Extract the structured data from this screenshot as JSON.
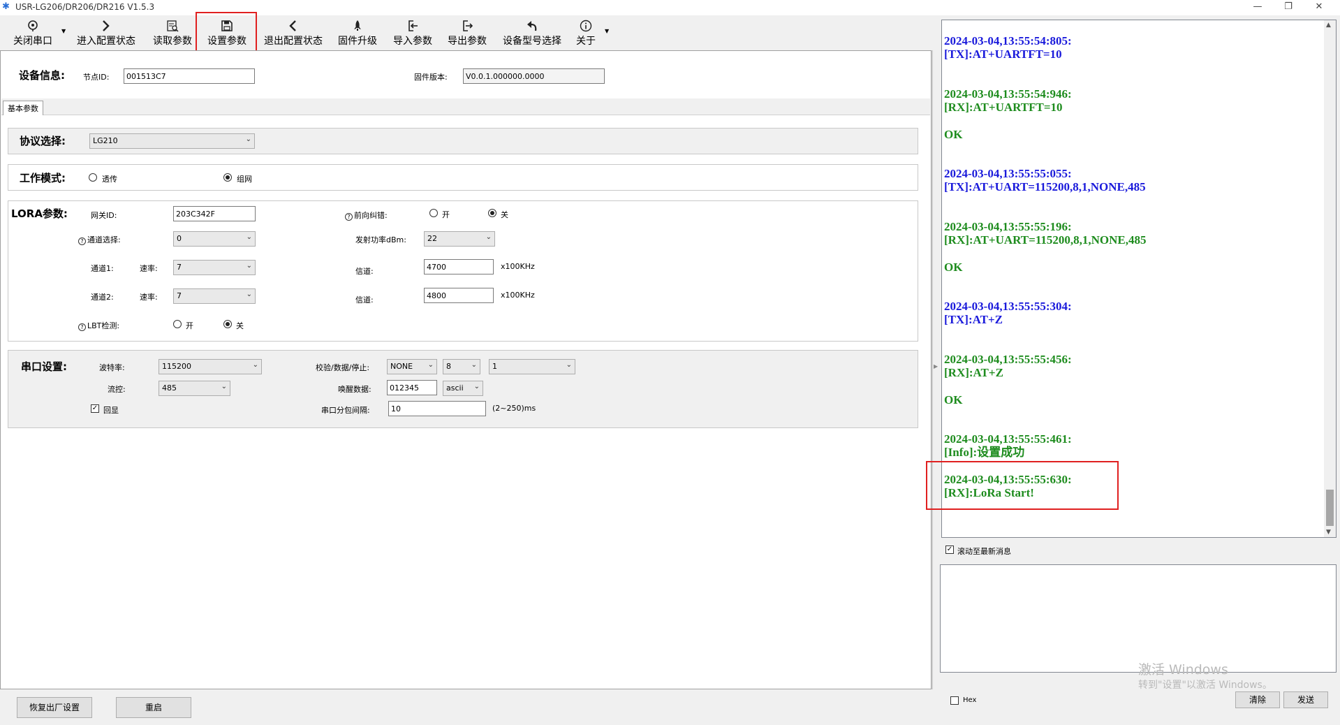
{
  "window": {
    "title": "USR-LG206/DR206/DR216 V1.5.3",
    "controls": [
      "—",
      "❐",
      "✕"
    ]
  },
  "toolbar": {
    "items": [
      {
        "name": "close-port",
        "label": "关闭串口",
        "icon": "close-port-icon"
      },
      {
        "name": "enter-config",
        "label": "进入配置状态",
        "icon": "chevron-right-icon"
      },
      {
        "name": "read-params",
        "label": "读取参数",
        "icon": "read-params-icon"
      },
      {
        "name": "set-params",
        "label": "设置参数",
        "icon": "save-icon"
      },
      {
        "name": "exit-config",
        "label": "退出配置状态",
        "icon": "chevron-left-icon"
      },
      {
        "name": "firmware-upgrade",
        "label": "固件升级",
        "icon": "rocket-icon"
      },
      {
        "name": "import-params",
        "label": "导入参数",
        "icon": "import-icon"
      },
      {
        "name": "export-params",
        "label": "导出参数",
        "icon": "export-icon"
      },
      {
        "name": "model-select",
        "label": "设备型号选择",
        "icon": "undo-arrow-icon"
      },
      {
        "name": "about",
        "label": "关于",
        "icon": "info-icon"
      }
    ]
  },
  "device_info": {
    "title": "设备信息:",
    "node_id_label": "节点ID:",
    "node_id": "001513C7",
    "fw_label": "固件版本:",
    "fw_version": "V0.0.1.000000.0000"
  },
  "tabs": [
    "基本参数"
  ],
  "protocol": {
    "title": "协议选择:",
    "value": "LG210"
  },
  "work_mode": {
    "title": "工作模式:",
    "opt1": "透传",
    "opt2": "组网",
    "selected": "组网"
  },
  "lora": {
    "title": "LORA参数:",
    "gateway_label": "网关ID:",
    "gateway_id": "203C342F",
    "fec_label": "前向纠错:",
    "fec_on": "开",
    "fec_off": "关",
    "channel_select_label": "通道选择:",
    "channel_select": "0",
    "tx_power_label": "发射功率dBm:",
    "tx_power": "22",
    "ch1_label": "通道1:",
    "rate_label": "速率:",
    "ch1_rate": "7",
    "ch1_channel_label": "信道:",
    "ch1_channel": "4700",
    "ch2_label": "通道2:",
    "ch2_rate": "7",
    "ch2_channel_label": "信道:",
    "ch2_channel": "4800",
    "unit": "x100KHz",
    "lbt_label": "LBT检测:",
    "lbt_on": "开",
    "lbt_off": "关"
  },
  "serial": {
    "title": "串口设置:",
    "baud_label": "波特率:",
    "baud": "115200",
    "flow_label": "流控:",
    "flow": "485",
    "echo_label": "回显",
    "parity_label": "校验/数据/停止:",
    "parity": "NONE",
    "data_bits": "8",
    "stop_bits": "1",
    "wake_label": "唤醒数据:",
    "wake_data": "012345",
    "wake_fmt": "ascii",
    "interval_label": "串口分包间隔:",
    "interval": "10",
    "interval_unit": "(2~250)ms"
  },
  "bottom": {
    "factory_reset": "恢复出厂设置",
    "restart": "重启"
  },
  "log": {
    "entries": [
      {
        "time": "2024-03-04,13:55:54:805:",
        "msg": "[TX]:AT+UARTFT=10",
        "color": "#1a1adb"
      },
      {
        "time": "2024-03-04,13:55:54:946:",
        "msg": "[RX]:AT+UARTFT=10",
        "color": "#1e8c1e"
      },
      {
        "time": "",
        "msg": "OK",
        "color": "#1e8c1e"
      },
      {
        "time": "2024-03-04,13:55:55:055:",
        "msg": "[TX]:AT+UART=115200,8,1,NONE,485",
        "color": "#1a1adb"
      },
      {
        "time": "2024-03-04,13:55:55:196:",
        "msg": "[RX]:AT+UART=115200,8,1,NONE,485",
        "color": "#1e8c1e"
      },
      {
        "time": "",
        "msg": "OK",
        "color": "#1e8c1e"
      },
      {
        "time": "2024-03-04,13:55:55:304:",
        "msg": "[TX]:AT+Z",
        "color": "#1a1adb"
      },
      {
        "time": "2024-03-04,13:55:55:456:",
        "msg": "[RX]:AT+Z",
        "color": "#1e8c1e"
      },
      {
        "time": "",
        "msg": "OK",
        "color": "#1e8c1e"
      },
      {
        "time": "2024-03-04,13:55:55:461:",
        "msg": "[Info]:设置成功",
        "color": "#1e8c1e"
      },
      {
        "time": "2024-03-04,13:55:55:630:",
        "msg": "[RX]:LoRa Start!",
        "color": "#1e8c1e"
      }
    ],
    "scroll_latest_label": "滚动至最新消息",
    "hex_label": "Hex",
    "clear_label": "清除",
    "send_label": "发送"
  },
  "watermark": {
    "line1": "激活 Windows",
    "line2": "转到\"设置\"以激活 Windows。"
  }
}
